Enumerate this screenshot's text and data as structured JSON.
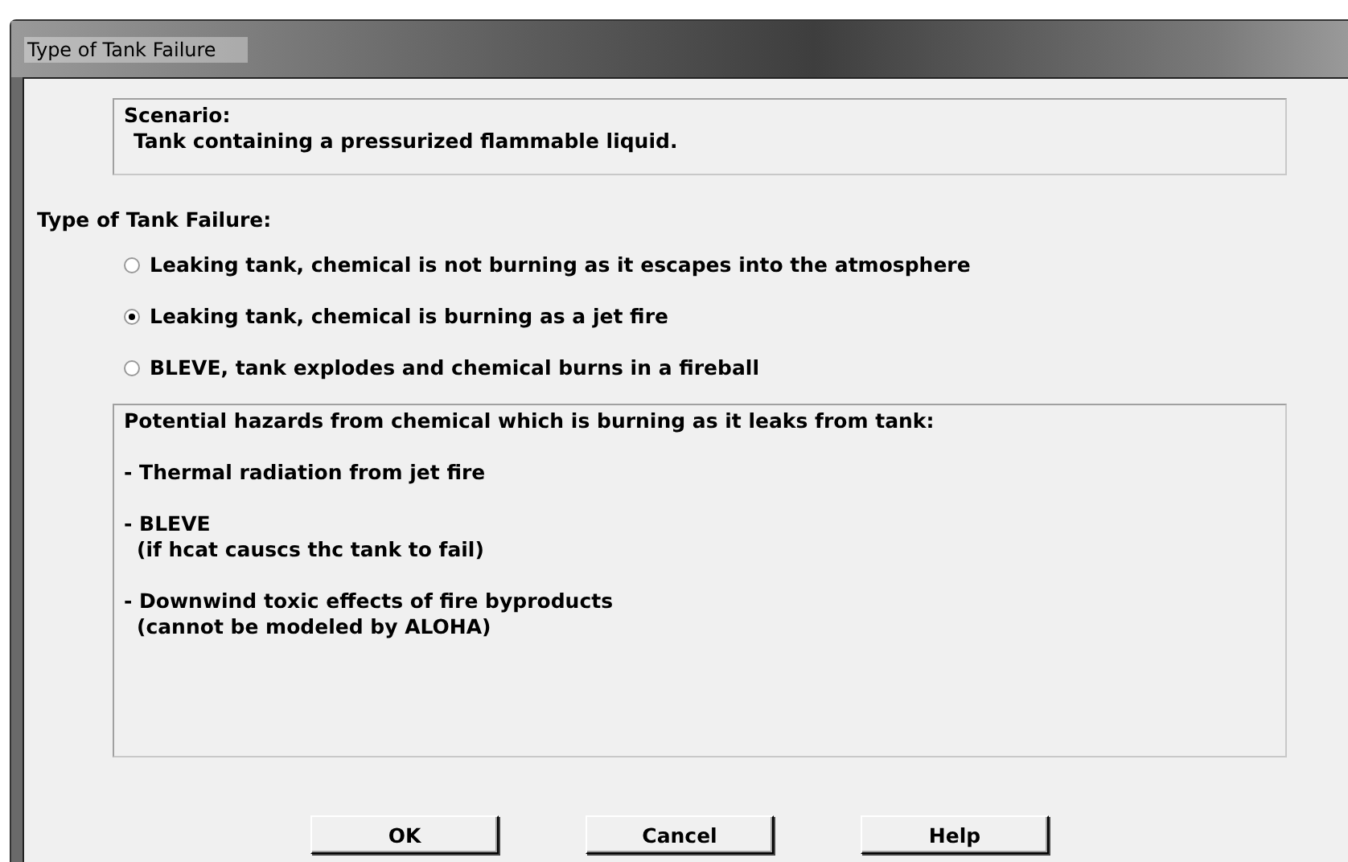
{
  "window": {
    "title": "Type of Tank Failure"
  },
  "scenario": {
    "heading": "Scenario:",
    "text": "Tank containing a pressurized flammable liquid."
  },
  "failure_type": {
    "label": "Type of Tank Failure:",
    "options": [
      {
        "label": "Leaking tank, chemical is not burning as it escapes into the atmosphere",
        "selected": false
      },
      {
        "label": "Leaking tank, chemical is burning as a jet fire",
        "selected": true
      },
      {
        "label": "BLEVE, tank explodes and chemical burns in a fireball",
        "selected": false
      }
    ]
  },
  "hazards": {
    "heading": "Potential hazards from chemical which is burning as it leaks from tank:",
    "items": [
      {
        "title": "- Thermal radiation from jet fire"
      },
      {
        "title": "- BLEVE",
        "note": "(if hcat causcs thc tank to fail)"
      },
      {
        "title": "- Downwind toxic effects of fire byproducts",
        "note": "(cannot be modeled by ALOHA)"
      }
    ]
  },
  "buttons": [
    "OK",
    "Cancel",
    "Help"
  ]
}
